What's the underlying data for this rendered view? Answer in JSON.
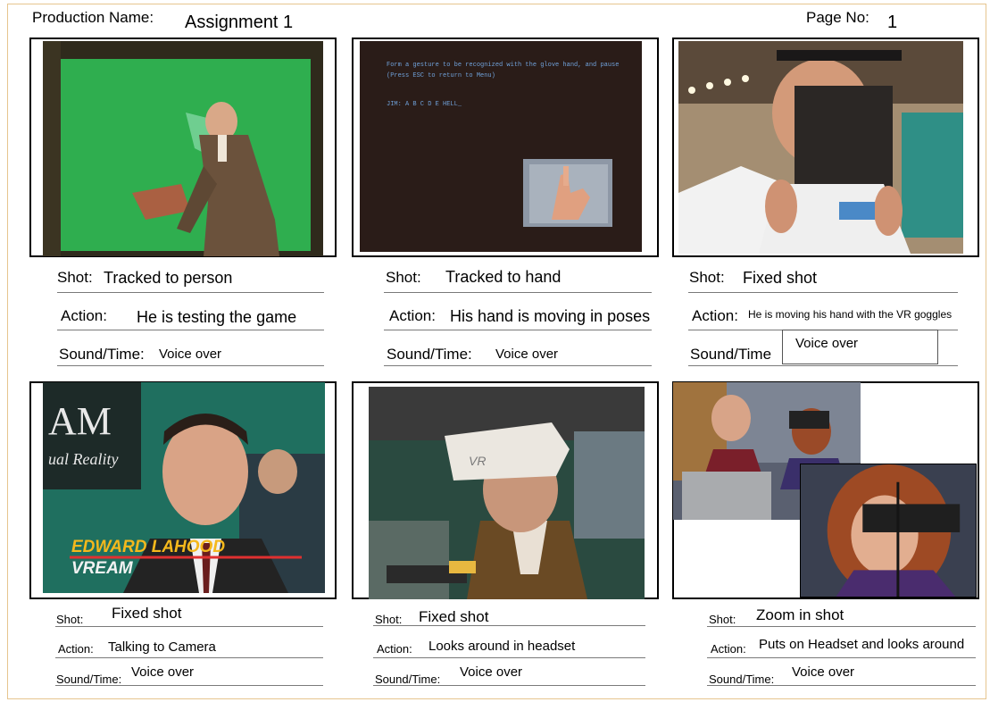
{
  "header": {
    "production_label": "Production Name:",
    "production_value": "Assignment 1",
    "page_label": "Page No:",
    "page_value": "1"
  },
  "panels": [
    {
      "shot_label": "Shot:",
      "shot": "Tracked to person",
      "action_label": "Action:",
      "action": "He is testing the game",
      "sound_label": "Sound/Time:",
      "sound": "Voice over"
    },
    {
      "shot_label": "Shot:",
      "shot": "Tracked to hand",
      "action_label": "Action:",
      "action": "His hand is moving in poses",
      "sound_label": "Sound/Time:",
      "sound": "Voice over",
      "screen_text_1": "Form a gesture to be recognized with the glove hand, and pause",
      "screen_text_2": "(Press ESC to return to Menu)",
      "screen_text_3": "JIM:  A B C D E HELL_"
    },
    {
      "shot_label": "Shot:",
      "shot": "Fixed shot",
      "action_label": "Action:",
      "action": "He is moving his hand with the VR goggles",
      "sound_label": "Sound/Time",
      "sound": "Voice over"
    },
    {
      "shot_label": "Shot:",
      "shot": "Fixed shot",
      "action_label": "Action:",
      "action": "Talking to Camera",
      "sound_label": "Sound/Time:",
      "sound": "Voice over",
      "caption_name": "EDWARD LAHOOD",
      "caption_org": "VREAM",
      "sign_text_1": "AM",
      "sign_text_2": "ual Reality"
    },
    {
      "shot_label": "Shot:",
      "shot": "Fixed shot",
      "action_label": "Action:",
      "action": "Looks around in headset",
      "sound_label": "Sound/Time:",
      "sound": "Voice over",
      "headset_text": "VR"
    },
    {
      "shot_label": "Shot:",
      "shot": "Zoom in shot",
      "action_label": "Action:",
      "action": "Puts on Headset and looks around",
      "sound_label": "Sound/Time:",
      "sound": "Voice over"
    }
  ]
}
